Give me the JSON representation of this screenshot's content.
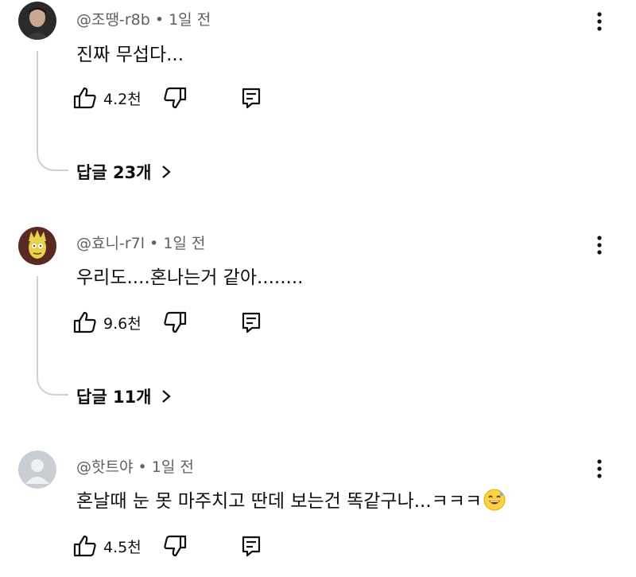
{
  "comments": [
    {
      "author": "@조땡-r8b",
      "sep": "•",
      "time": "1일 전",
      "text": "진짜 무섭다...",
      "likes": "4.2천",
      "replies_label": "답글 23개"
    },
    {
      "author": "@효니-r7l",
      "sep": "•",
      "time": "1일 전",
      "text": "우리도....혼나는거 같아........",
      "likes": "9.6천",
      "replies_label": "답글 11개"
    },
    {
      "author": "@핫트야",
      "sep": "•",
      "time": "1일 전",
      "text": "혼날때 눈 못 마주치고 딴데 보는건 똑같구나...ㅋㅋㅋ",
      "emoji": "grinning-sweat-emoji",
      "likes": "4.5천"
    }
  ],
  "icons": {
    "like": "thumbs-up-icon",
    "dislike": "thumbs-down-icon",
    "reply": "reply-comment-icon",
    "more": "more-vertical-icon",
    "chevron": "chevron-right-icon"
  },
  "colors": {
    "meta_text": "#606060",
    "thread_line": "#d0d0d0",
    "default_avatar_bg": "#c9ced4"
  }
}
